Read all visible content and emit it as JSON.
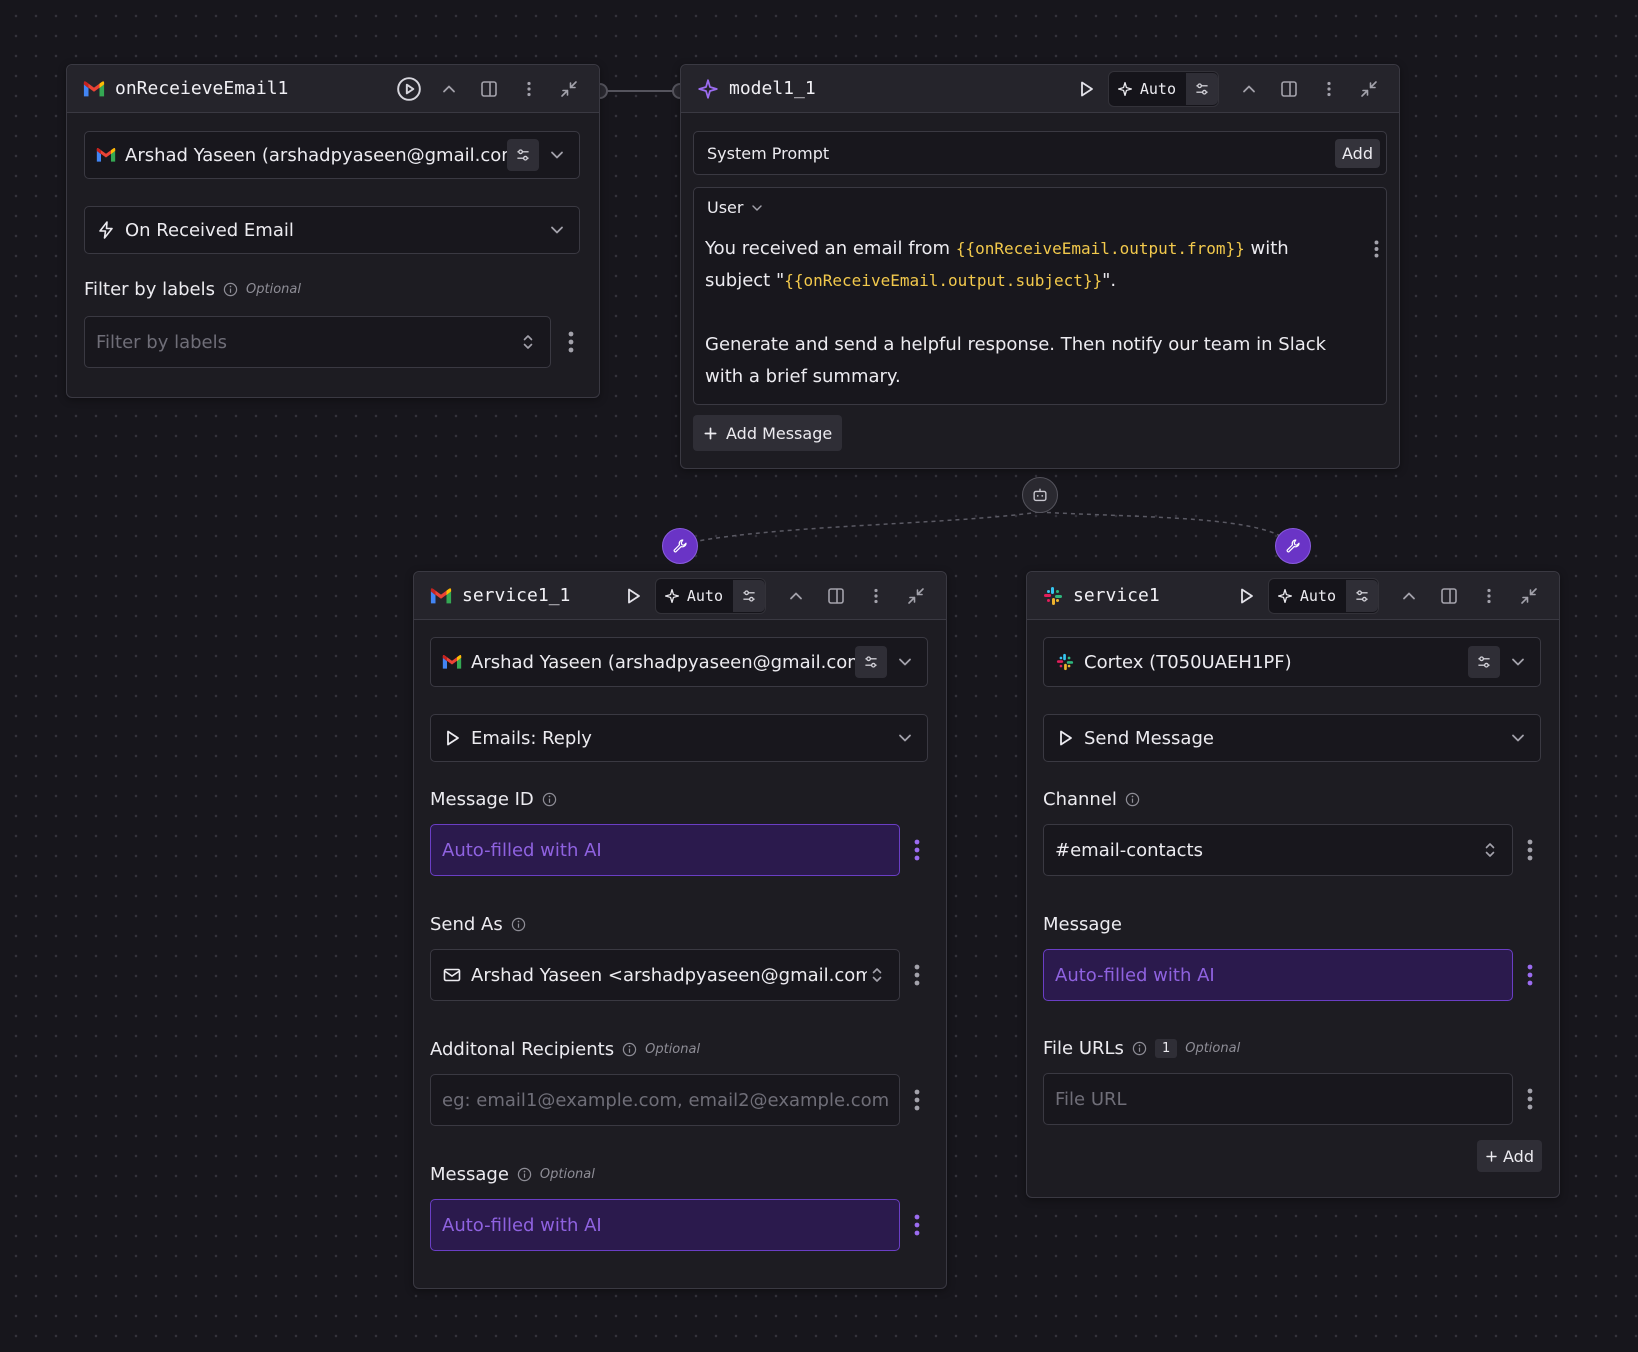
{
  "colors": {
    "canvas": "#17161c",
    "node_bg": "#1d1c22",
    "ai_fill": "#2b1a4d",
    "ai_border": "#6a3ec4",
    "ai_text": "#8f62e0",
    "accent_purple": "#6a34c6",
    "variable_yellow": "#f2c94c"
  },
  "trigger_node": {
    "title": "onReceieveEmail1",
    "icon": "gmail-logo",
    "account": "Arshad Yaseen (arshadpyaseen@gmail.com)",
    "event": "On Received Email",
    "filter_label": "Filter by labels",
    "filter_optional": "Optional",
    "filter_placeholder": "Filter by labels"
  },
  "model_node": {
    "title": "model1_1",
    "auto_label": "Auto",
    "system_prompt_label": "System Prompt",
    "system_prompt_add": "Add",
    "role": "User",
    "message_part1": "You received an email from ",
    "message_var1": "{{onReceiveEmail.output.from}}",
    "message_part2": " with subject \"",
    "message_var2": "{{onReceiveEmail.output.subject}}",
    "message_part3": "\".",
    "message_para2": "Generate and send a helpful response. Then notify our team in Slack with a brief summary.",
    "add_message": "Add Message"
  },
  "gmail_service": {
    "title": "service1_1",
    "auto_label": "Auto",
    "account": "Arshad Yaseen (arshadpyaseen@gmail.com)",
    "action": "Emails: Reply",
    "message_id_label": "Message ID",
    "message_id_value": "Auto-filled with AI",
    "send_as_label": "Send As",
    "send_as_value": "Arshad Yaseen <arshadpyaseen@gmail.com>",
    "recipients_label": "Additonal Recipients",
    "recipients_optional": "Optional",
    "recipients_placeholder": "eg: email1@example.com, email2@example.com",
    "message_label": "Message",
    "message_optional": "Optional",
    "message_value": "Auto-filled with AI"
  },
  "slack_service": {
    "title": "service1",
    "auto_label": "Auto",
    "account": "Cortex (T050UAEH1PF)",
    "action": "Send Message",
    "channel_label": "Channel",
    "channel_value": "#email-contacts",
    "message_label": "Message",
    "message_value": "Auto-filled with AI",
    "file_urls_label": "File URLs",
    "file_urls_count": "1",
    "file_urls_optional": "Optional",
    "file_url_placeholder": "File URL",
    "add_label": "Add"
  }
}
